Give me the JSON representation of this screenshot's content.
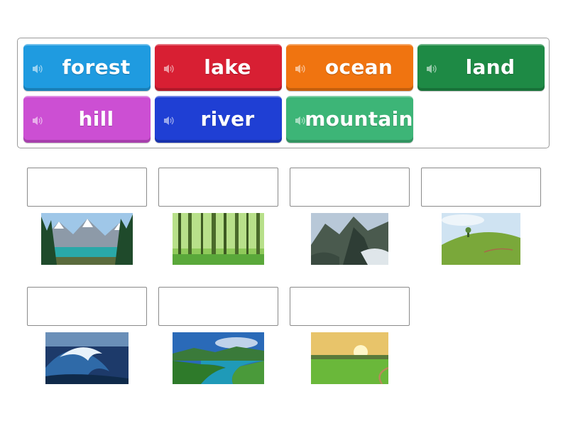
{
  "tiles": [
    {
      "label": "forest",
      "color": "#1f9be0",
      "icon": "speaker-icon"
    },
    {
      "label": "lake",
      "color": "#d81f33",
      "icon": "speaker-icon"
    },
    {
      "label": "ocean",
      "color": "#f07410",
      "icon": "speaker-icon"
    },
    {
      "label": "land",
      "color": "#1e8a45",
      "icon": "speaker-icon"
    },
    {
      "label": "hill",
      "color": "#cc4fd3",
      "icon": "speaker-icon"
    },
    {
      "label": "river",
      "color": "#1f3fd4",
      "icon": "speaker-icon"
    },
    {
      "label": "mountain",
      "color": "#3db577",
      "icon": "speaker-icon"
    }
  ],
  "images": [
    "lake-photo",
    "forest-photo",
    "mountain-photo",
    "hill-photo",
    "ocean-wave-photo",
    "river-photo",
    "land-field-photo"
  ]
}
